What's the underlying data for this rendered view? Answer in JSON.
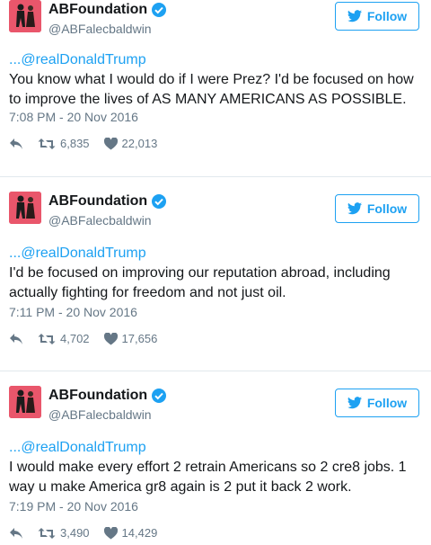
{
  "tweets": [
    {
      "display_name": "ABFoundation",
      "handle": "@ABFalecbaldwin",
      "follow_label": "Follow",
      "mention": "...@realDonaldTrump",
      "body": "You know what I would do if I were Prez? I'd be focused on how to improve the lives of AS MANY AMERICANS AS POSSIBLE.",
      "timestamp": "7:08 PM - 20 Nov 2016",
      "retweets": "6,835",
      "likes": "22,013"
    },
    {
      "display_name": "ABFoundation",
      "handle": "@ABFalecbaldwin",
      "follow_label": "Follow",
      "mention": "...@realDonaldTrump",
      "body": "I'd be focused on improving our reputation abroad, including actually fighting for freedom and not just oil.",
      "timestamp": "7:11 PM - 20 Nov 2016",
      "retweets": "4,702",
      "likes": "17,656"
    },
    {
      "display_name": "ABFoundation",
      "handle": "@ABFalecbaldwin",
      "follow_label": "Follow",
      "mention": "...@realDonaldTrump",
      "body": "I would make every effort 2 retrain Americans so 2 cre8 jobs. 1 way u make America gr8 again is 2 put it back 2 work.",
      "timestamp": "7:19 PM - 20 Nov 2016",
      "retweets": "3,490",
      "likes": "14,429"
    }
  ],
  "colors": {
    "accent": "#1da1f2",
    "secondary_text": "#657786",
    "avatar_bg": "#e9566b"
  },
  "icons": [
    "verified-icon",
    "twitter-bird-icon",
    "reply-icon",
    "retweet-icon",
    "heart-icon"
  ]
}
